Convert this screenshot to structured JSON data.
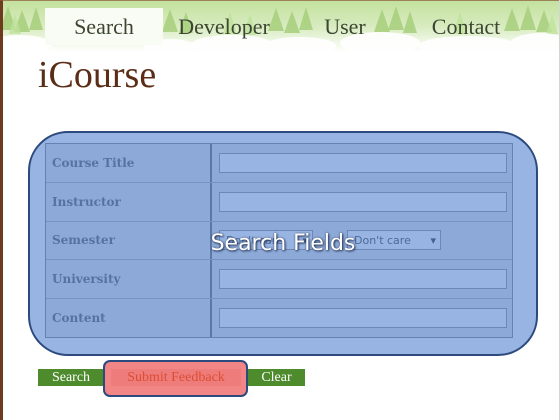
{
  "nav": {
    "tabs": [
      {
        "label": "Search",
        "active": true
      },
      {
        "label": "Developer",
        "active": false
      },
      {
        "label": "User",
        "active": false
      },
      {
        "label": "Contact",
        "active": false
      }
    ]
  },
  "header": {
    "title": "iCourse"
  },
  "search_form": {
    "fields": [
      {
        "label": "Course Title",
        "value": ""
      },
      {
        "label": "Instructor",
        "value": ""
      },
      {
        "label": "Semester",
        "selects": [
          {
            "selected": "Don't care",
            "icon": "chevron-down-icon"
          },
          {
            "selected": "Don't care",
            "icon": "chevron-down-icon"
          }
        ]
      },
      {
        "label": "University",
        "value": ""
      },
      {
        "label": "Content",
        "value": ""
      }
    ]
  },
  "annotations": {
    "search_fields_label": "Search Fields"
  },
  "buttons": {
    "search": "Search",
    "submit_feedback": "Submit Feedback",
    "clear": "Clear"
  },
  "colors": {
    "title": "#5c2d16",
    "nav_text": "#3b4530",
    "button_green": "#4d8b2d",
    "annotation_blue_border": "#2d4a7f",
    "annotation_red_fill": "#f28585",
    "feedback_text": "#dc4e34"
  }
}
